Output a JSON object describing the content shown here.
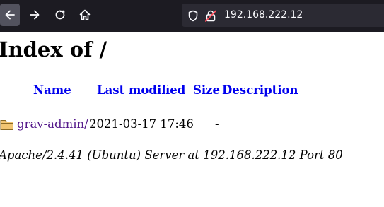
{
  "browser": {
    "url": "192.168.222.12",
    "icons": [
      "back-arrow-icon",
      "forward-arrow-icon",
      "reload-icon",
      "home-icon",
      "shield-icon",
      "insecure-lock-icon"
    ]
  },
  "page": {
    "title": "Index of /",
    "columns": [
      "Name",
      "Last modified",
      "Size",
      "Description"
    ],
    "rows": [
      {
        "icon": "folder-icon",
        "name": "grav-admin/",
        "modified": "2021-03-17 17:46",
        "size": "-",
        "description": ""
      }
    ],
    "footer": "Apache/2.4.41 (Ubuntu) Server at 192.168.222.12 Port 80"
  },
  "colors": {
    "toolbar": "#1c1b22",
    "urlbar": "#2b2a33",
    "link": "#0000ee",
    "visited_link": "#551a8b"
  }
}
